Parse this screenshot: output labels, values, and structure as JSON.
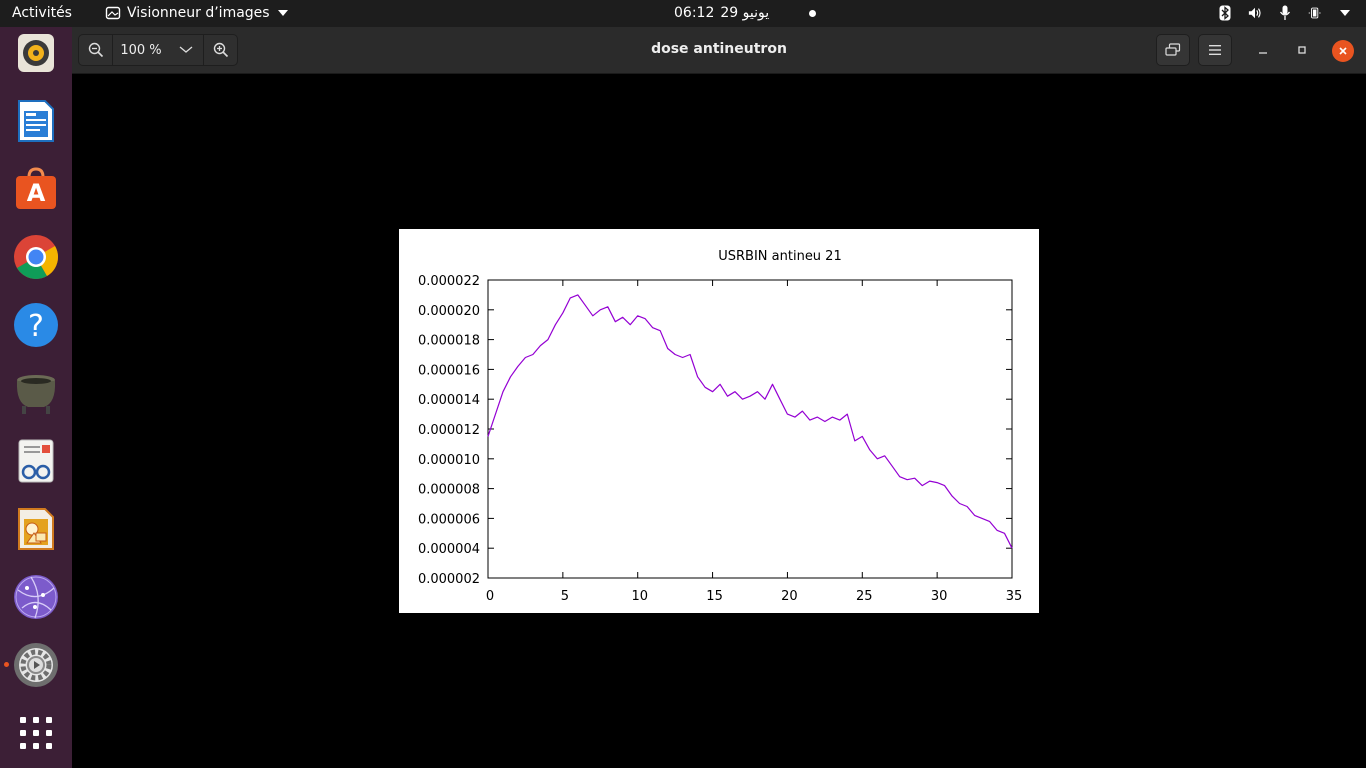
{
  "topbar": {
    "activities": "Activités",
    "app_name": "Visionneur d’images",
    "clock_time": "06:12",
    "clock_date": "29 يونيو"
  },
  "dock": {
    "items": [
      "rhythmbox-icon",
      "writer-icon",
      "software-center-icon",
      "chrome-icon",
      "help-icon",
      "cauldron-icon",
      "document-viewer-icon",
      "draw-icon",
      "web-browser-icon",
      "settings-icon",
      "app-grid-icon"
    ]
  },
  "header": {
    "zoom": "100 %",
    "title": "dose antineutron"
  },
  "chart_data": {
    "type": "line",
    "title": "USRBIN antineu 21",
    "xlabel": "",
    "ylabel": "",
    "xlim": [
      0,
      35
    ],
    "ylim": [
      2e-06,
      2.2e-05
    ],
    "x_ticks": [
      "0",
      "5",
      "10",
      "15",
      "20",
      "25",
      "30",
      "35"
    ],
    "y_ticks": [
      "0.000002",
      "0.000004",
      "0.000006",
      "0.000008",
      "0.000010",
      "0.000012",
      "0.000014",
      "0.000016",
      "0.000018",
      "0.000020",
      "0.000022"
    ],
    "color": "#9400d3",
    "grid": false,
    "series": [
      {
        "x": [
          0,
          0.5,
          1,
          1.5,
          2,
          2.5,
          3,
          3.5,
          4,
          4.5,
          5,
          5.5,
          6,
          6.5,
          7,
          7.5,
          8,
          8.5,
          9,
          9.5,
          10,
          10.5,
          11,
          11.5,
          12,
          12.5,
          13,
          13.5,
          14,
          14.5,
          15,
          15.5,
          16,
          16.5,
          17,
          17.5,
          18,
          18.5,
          19,
          19.5,
          20,
          20.5,
          21,
          21.5,
          22,
          22.5,
          23,
          23.5,
          24,
          24.5,
          25,
          25.5,
          26,
          26.5,
          27,
          27.5,
          28,
          28.5,
          29,
          29.5,
          30,
          30.5,
          31,
          31.5,
          32,
          32.5,
          33,
          33.5,
          34,
          34.5,
          35
        ],
        "y": [
          1.15e-05,
          1.3e-05,
          1.45e-05,
          1.55e-05,
          1.62e-05,
          1.68e-05,
          1.7e-05,
          1.76e-05,
          1.8e-05,
          1.9e-05,
          1.98e-05,
          2.08e-05,
          2.1e-05,
          2.03e-05,
          1.96e-05,
          2e-05,
          2.02e-05,
          1.92e-05,
          1.95e-05,
          1.9e-05,
          1.96e-05,
          1.94e-05,
          1.88e-05,
          1.86e-05,
          1.74e-05,
          1.7e-05,
          1.68e-05,
          1.7e-05,
          1.55e-05,
          1.48e-05,
          1.45e-05,
          1.5e-05,
          1.42e-05,
          1.45e-05,
          1.4e-05,
          1.42e-05,
          1.45e-05,
          1.4e-05,
          1.5e-05,
          1.4e-05,
          1.3e-05,
          1.28e-05,
          1.32e-05,
          1.26e-05,
          1.28e-05,
          1.25e-05,
          1.28e-05,
          1.26e-05,
          1.3e-05,
          1.12e-05,
          1.15e-05,
          1.06e-05,
          1e-05,
          1.02e-05,
          9.5e-06,
          8.8e-06,
          8.6e-06,
          8.7e-06,
          8.2e-06,
          8.5e-06,
          8.4e-06,
          8.2e-06,
          7.5e-06,
          7e-06,
          6.8e-06,
          6.2e-06,
          6e-06,
          5.8e-06,
          5.2e-06,
          5e-06,
          4e-06
        ]
      }
    ]
  }
}
